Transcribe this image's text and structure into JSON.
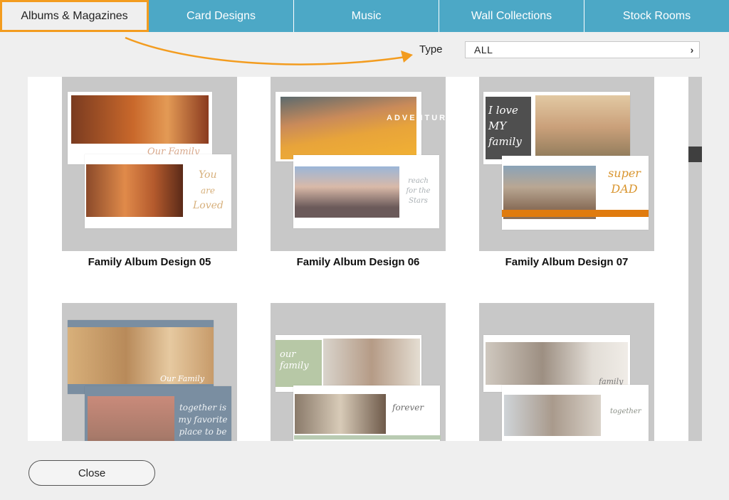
{
  "tabs": [
    {
      "label": "Albums & Magazines",
      "active": true
    },
    {
      "label": "Card Designs"
    },
    {
      "label": "Music"
    },
    {
      "label": "Wall Collections"
    },
    {
      "label": "Stock Rooms"
    }
  ],
  "filter": {
    "label": "Type",
    "value": "ALL"
  },
  "designs": [
    {
      "title": "Family Album Design 05",
      "texts": [
        "Our Family",
        "You",
        "are",
        "Loved"
      ]
    },
    {
      "title": "Family Album Design 06",
      "texts": [
        "ADVENTURE",
        "reach for the Stars"
      ]
    },
    {
      "title": "Family Album Design 07",
      "texts": [
        "I love MY family",
        "super DAD"
      ]
    },
    {
      "texts": [
        "Our Family",
        "together is my favorite place to be"
      ]
    },
    {
      "texts": [
        "our family",
        "forever"
      ]
    },
    {
      "texts": [
        "family",
        "together"
      ]
    }
  ],
  "footer": {
    "close_label": "Close"
  },
  "colors": {
    "tab_bg": "#4ca8c6",
    "highlight": "#f39c1f",
    "thumb_bg": "#c8c8c8"
  }
}
